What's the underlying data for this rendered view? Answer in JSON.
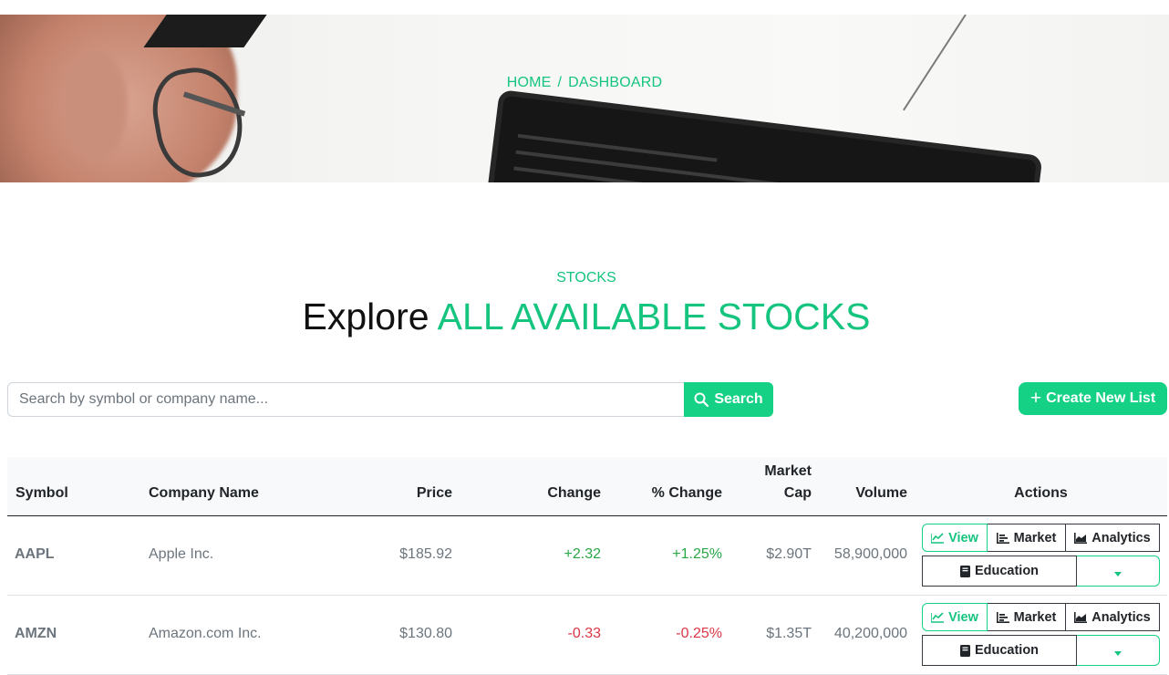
{
  "breadcrumb": {
    "home": "HOME",
    "separator": "/",
    "current": "DASHBOARD"
  },
  "section": {
    "eyebrow": "STOCKS",
    "title_lead": "Explore",
    "title_accent": "ALL AVAILABLE STOCKS"
  },
  "search": {
    "placeholder": "Search by symbol or company name...",
    "value": "",
    "button_label": "Search",
    "button_icon": "search-icon"
  },
  "create_button": {
    "label": "Create New List",
    "icon": "plus-icon"
  },
  "colors": {
    "accent": "#15d185",
    "positive": "#28a745",
    "negative": "#dc3545"
  },
  "table": {
    "headers": {
      "symbol": "Symbol",
      "company": "Company Name",
      "price": "Price",
      "change": "Change",
      "pct_change": "% Change",
      "market_cap_line1": "Market",
      "market_cap_line2": "Cap",
      "volume": "Volume",
      "actions": "Actions"
    },
    "action_labels": {
      "view": "View",
      "market": "Market",
      "analytics": "Analytics",
      "education": "Education"
    },
    "rows": [
      {
        "symbol": "AAPL",
        "company": "Apple Inc.",
        "price": "$185.92",
        "change": "+2.32",
        "pct_change": "+1.25%",
        "market_cap": "$2.90T",
        "volume": "58,900,000",
        "direction": "up"
      },
      {
        "symbol": "AMZN",
        "company": "Amazon.com Inc.",
        "price": "$130.80",
        "change": "-0.33",
        "pct_change": "-0.25%",
        "market_cap": "$1.35T",
        "volume": "40,200,000",
        "direction": "down"
      }
    ]
  }
}
